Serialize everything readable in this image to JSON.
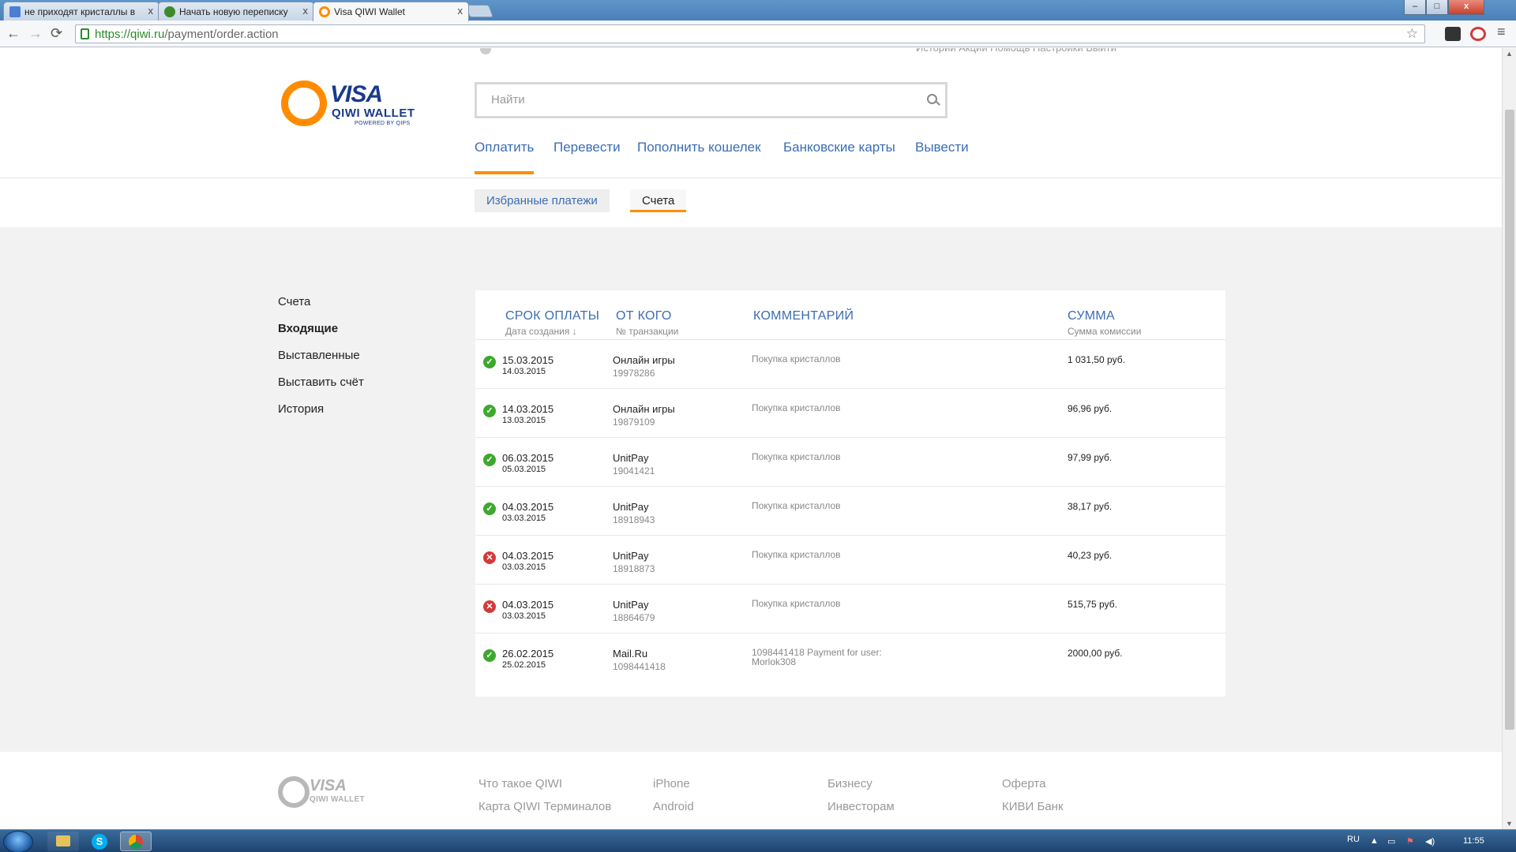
{
  "browser": {
    "tabs": [
      {
        "title": "не приходят кристаллы в",
        "favicon_color": "#4a7fd4"
      },
      {
        "title": "Начать новую переписку",
        "favicon_color": "#3d8a2c"
      },
      {
        "title": "Visa QIWI Wallet",
        "favicon_color": "#ff8c00"
      }
    ],
    "url_host": "https://qiwi.ru",
    "url_path": "/payment/order.action",
    "window_buttons": {
      "minimize": "–",
      "maximize": "□",
      "close": "x"
    },
    "tab_close": "x",
    "nav_icons": {
      "back": "←",
      "forward": "→",
      "reload": "⟳",
      "star": "☆",
      "menu": "≡"
    }
  },
  "page": {
    "header_cut": {
      "text": "Историй   Акции   Помощь   Настройки   Выйти"
    },
    "logo": {
      "visa": "VISA",
      "qiwi": "QIWI WALLET",
      "powered": "POWERED BY QIPS"
    },
    "search": {
      "placeholder": "Найти"
    },
    "main_nav": [
      "Оплатить",
      "Перевести",
      "Пополнить кошелек",
      "Банковские карты",
      "Вывести"
    ],
    "sub_tabs": [
      "Избранные платежи",
      "Счета"
    ],
    "side_menu": [
      "Счета",
      "Входящие",
      "Выставленные",
      "Выставить счёт",
      "История"
    ],
    "table": {
      "headers": [
        {
          "title": "СРОК ОПЛАТЫ",
          "sub": "Дата создания ↓"
        },
        {
          "title": "ОТ КОГО",
          "sub": "№ транзакции"
        },
        {
          "title": "КОММЕНТАРИЙ",
          "sub": ""
        },
        {
          "title": "СУММА",
          "sub": "Сумма комиссии"
        }
      ],
      "rows": [
        {
          "status": "ok",
          "due": "15.03.2015",
          "created": "14.03.2015",
          "from": "Онлайн игры",
          "txn": "19978286",
          "comment": "Покупка кристаллов",
          "amount": "1 031,50 руб."
        },
        {
          "status": "ok",
          "due": "14.03.2015",
          "created": "13.03.2015",
          "from": "Онлайн игры",
          "txn": "19879109",
          "comment": "Покупка кристаллов",
          "amount": "96,96 руб."
        },
        {
          "status": "ok",
          "due": "06.03.2015",
          "created": "05.03.2015",
          "from": "UnitPay",
          "txn": "19041421",
          "comment": "Покупка кристаллов",
          "amount": "97,99 руб."
        },
        {
          "status": "ok",
          "due": "04.03.2015",
          "created": "03.03.2015",
          "from": "UnitPay",
          "txn": "18918943",
          "comment": "Покупка кристаллов",
          "amount": "38,17 руб."
        },
        {
          "status": "fail",
          "due": "04.03.2015",
          "created": "03.03.2015",
          "from": "UnitPay",
          "txn": "18918873",
          "comment": "Покупка кристаллов",
          "amount": "40,23 руб."
        },
        {
          "status": "fail",
          "due": "04.03.2015",
          "created": "03.03.2015",
          "from": "UnitPay",
          "txn": "18864679",
          "comment": "Покупка кристаллов",
          "amount": "515,75 руб."
        },
        {
          "status": "ok",
          "due": "26.02.2015",
          "created": "25.02.2015",
          "from": "Mail.Ru",
          "txn": "1098441418",
          "comment": "1098441418 Payment for user: Morlok308",
          "amount": "2000,00 руб."
        }
      ]
    },
    "footer": {
      "logo": {
        "visa": "VISA",
        "qiwi": "QIWI WALLET"
      },
      "links": [
        [
          "Что такое QIWI",
          "Карта QIWI Терминалов"
        ],
        [
          "iPhone",
          "Android"
        ],
        [
          "Бизнесу",
          "Инвесторам"
        ],
        [
          "Оферта",
          "КИВИ Банк"
        ]
      ]
    }
  },
  "taskbar": {
    "lang": "RU",
    "clock": "11:55",
    "skype_label": "S"
  },
  "colors": {
    "link_blue": "#3b6db3",
    "accent_orange": "#ff8c00",
    "ok_green": "#3da82e",
    "fail_red": "#d23a3a",
    "page_gray": "#f2f2f2"
  }
}
